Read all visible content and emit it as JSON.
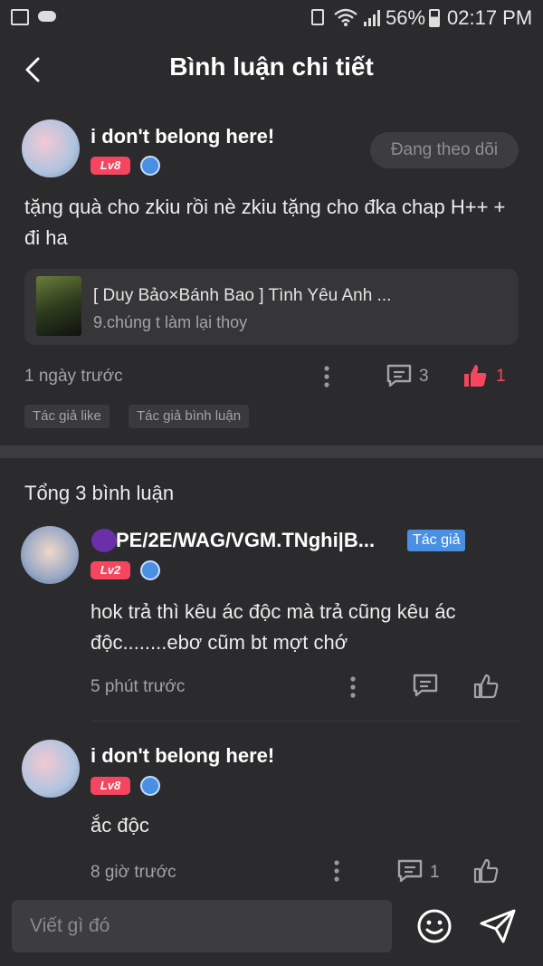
{
  "status_bar": {
    "battery": "56%",
    "time": "02:17 PM"
  },
  "header": {
    "title": "Bình luận chi tiết"
  },
  "post": {
    "username": "i don't belong here!",
    "level": "Lv8",
    "follow_button": "Đang theo dõi",
    "content": "tặng quà cho zkiu rồi nè zkiu tặng cho đka chap H++ + đi ha",
    "linked_title": "[ Duy Bảo×Bánh Bao ] Tình Yêu Anh ...",
    "linked_subtitle": "9.chúng t làm lại thoy",
    "time": "1 ngày trước",
    "comment_count": "3",
    "like_count": "1",
    "tags": [
      "Tác giả like",
      "Tác giả bình luận"
    ]
  },
  "comments_section": {
    "total_label": "Tổng 3 bình luận",
    "comments": [
      {
        "username": "PE/2E/WAG/VGM.TNghi|B...",
        "level": "Lv2",
        "author_badge": "Tác giả",
        "content": "hok trả thì kêu ác độc mà trả cũng kêu ác độc........ebơ cũm bt mợt chớ",
        "time": "5 phút trước",
        "reply_count": ""
      },
      {
        "username": "i don't belong here!",
        "level": "Lv8",
        "content": "ắc độc",
        "time": "8 giờ trước",
        "reply_count": "1"
      }
    ]
  },
  "input_bar": {
    "placeholder": "Viết gì đó"
  },
  "colors": {
    "background": "#2b2b2d",
    "accent_like": "#f5455f",
    "level_badge": "#f5455f",
    "author_badge": "#4a90e2"
  }
}
